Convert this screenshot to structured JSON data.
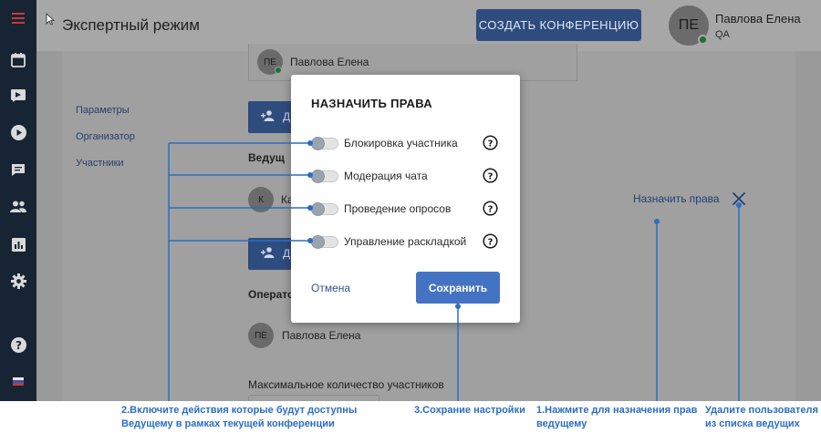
{
  "header": {
    "title": "Экспертный режим",
    "create_button": "СОЗДАТЬ КОНФЕРЕНЦИЮ",
    "user": {
      "initials": "ПЕ",
      "name": "Павлова Елена",
      "role": "QA"
    }
  },
  "sidebar": {
    "icons": [
      "menu-icon",
      "calendar-icon",
      "video-camera-icon",
      "play-icon",
      "chat-icon",
      "people-icon",
      "chart-icon",
      "gear-icon",
      "help-icon",
      "language-flag-icon"
    ]
  },
  "settings_nav": {
    "items": [
      {
        "label": "Параметры"
      },
      {
        "label": "Организатор"
      },
      {
        "label": "Участники"
      }
    ]
  },
  "page": {
    "top_participant": {
      "initials": "ПЕ",
      "name": "Павлова Елена"
    },
    "add_button_label": "Д",
    "hosts_heading": "Ведущ",
    "host": {
      "initials": "К",
      "name": "Ка"
    },
    "operators_heading": "Операто",
    "operator": {
      "initials": "ПЕ",
      "name": "Павлова Елена"
    },
    "max_participants_label": "Максимальное количество участников",
    "assign_rights_link": "Назначить права"
  },
  "modal": {
    "title": "НАЗНАЧИТЬ ПРАВА",
    "permissions": [
      {
        "label": "Блокировка участника",
        "enabled": false
      },
      {
        "label": "Модерация чата",
        "enabled": false
      },
      {
        "label": "Проведение опросов",
        "enabled": false
      },
      {
        "label": "Управление раскладкой",
        "enabled": false
      }
    ],
    "cancel_label": "Отмена",
    "save_label": "Сохранить"
  },
  "callouts": {
    "enable_actions": [
      "2.Включите действия которые будут доступны",
      "Ведущему в рамках текущей конференции"
    ],
    "save_settings": [
      "3.Сохрание настройки"
    ],
    "assign_rights": [
      "1.Нажмите для назначения прав",
      "ведущему"
    ],
    "remove_host": [
      "Удалите пользователя",
      "из списка ведущих"
    ]
  },
  "colors": {
    "accent": "#4473c4",
    "callout": "#2b6dc4",
    "sidebar": "#172433",
    "online": "#1e6e3d"
  }
}
